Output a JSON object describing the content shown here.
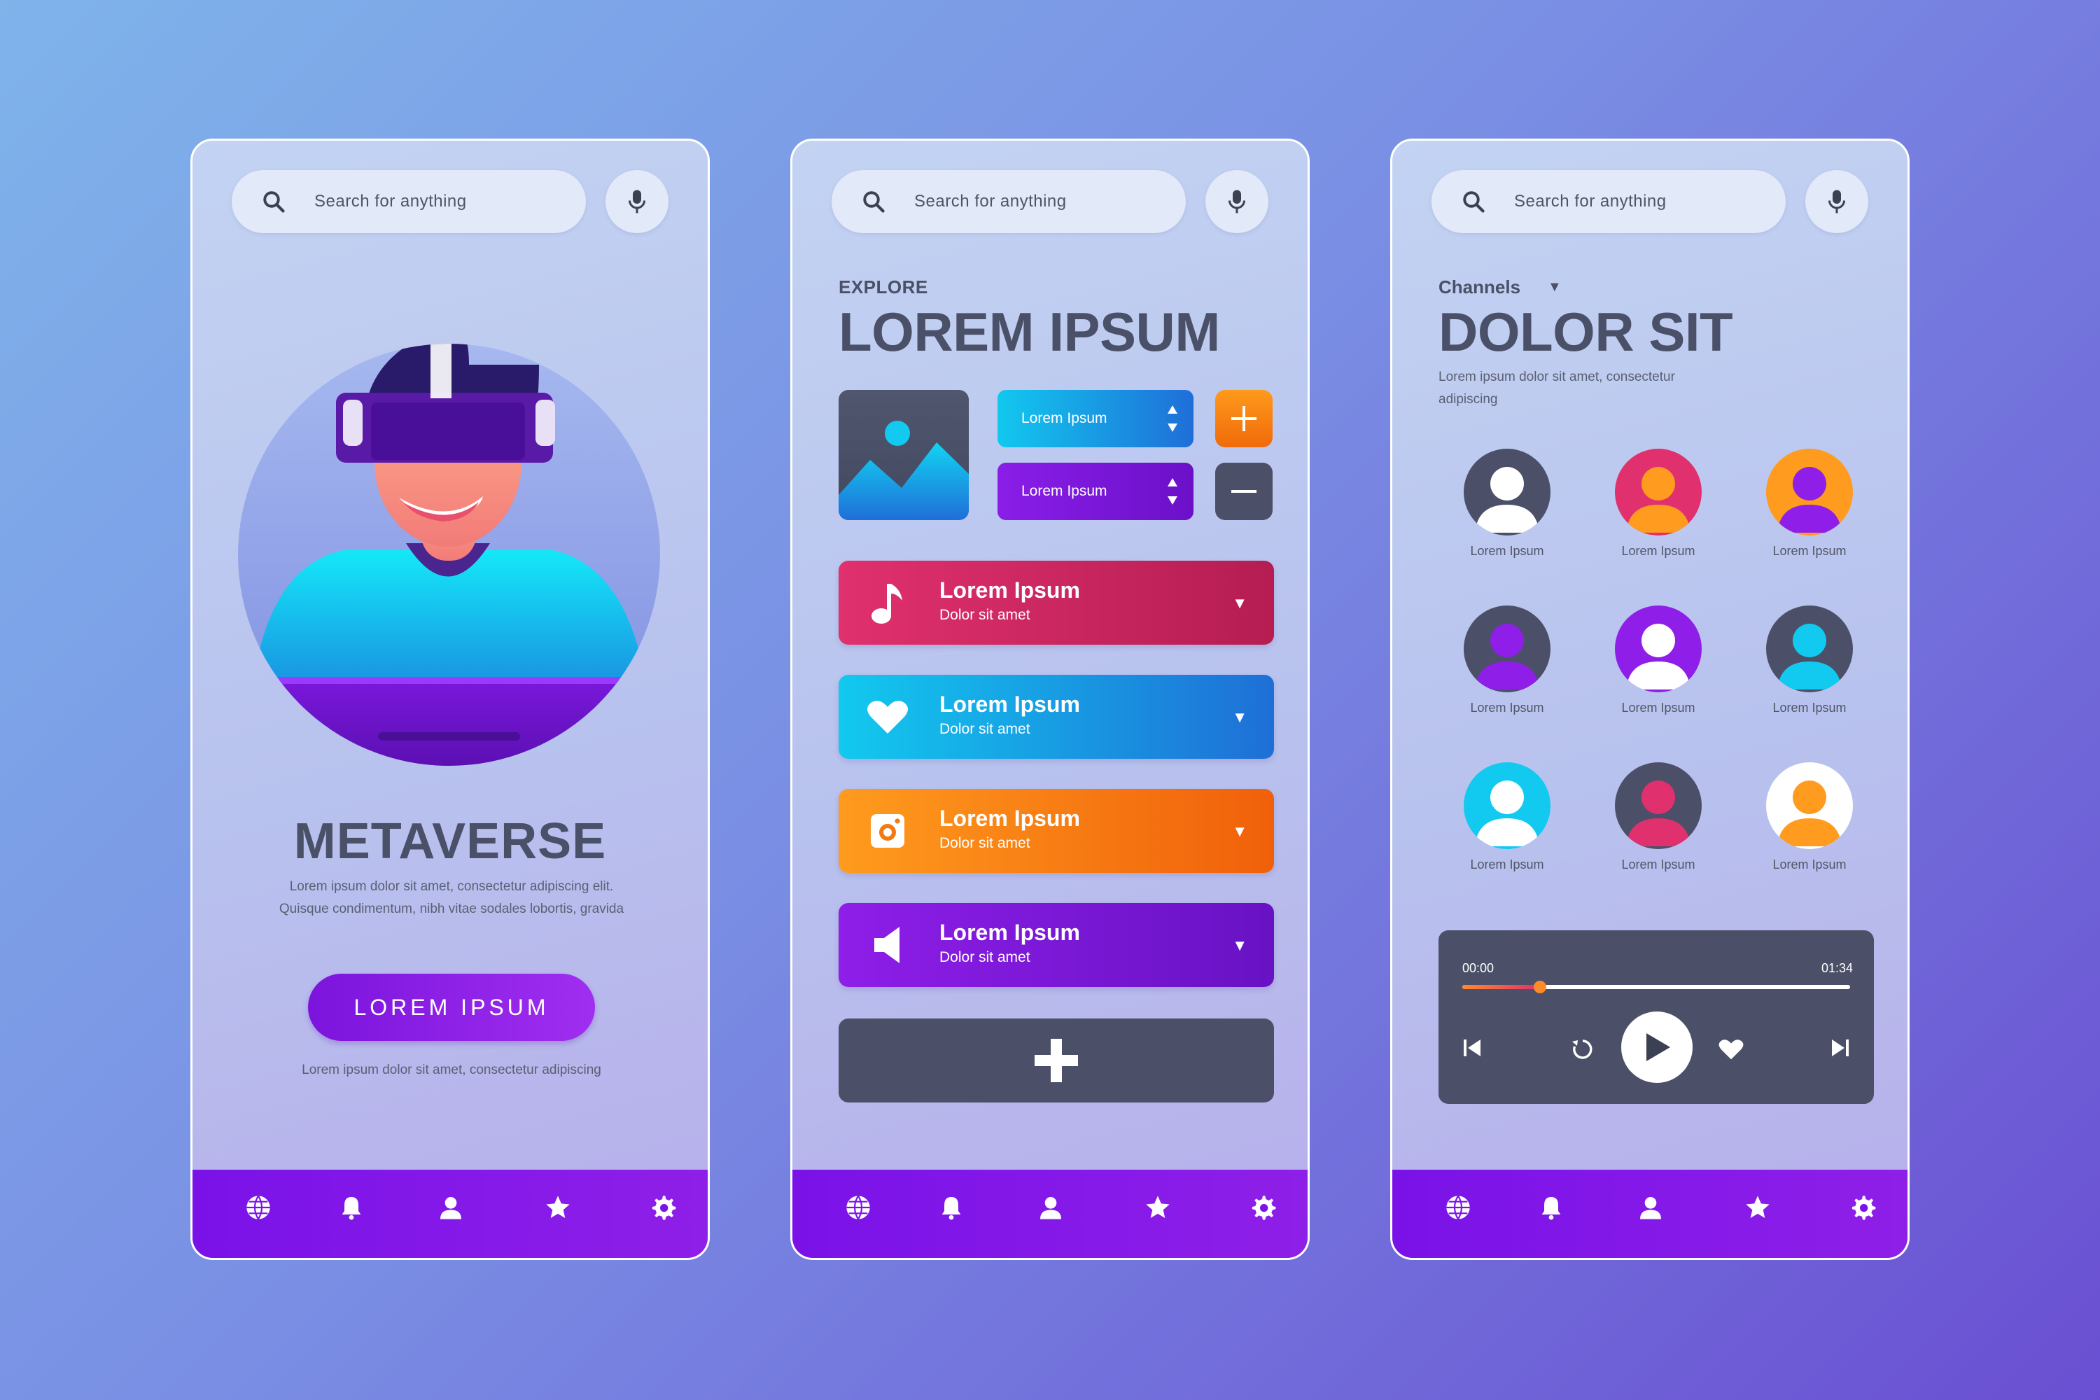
{
  "colors": {
    "accent_purple": "#7a12e8",
    "text_dark": "#4a5068",
    "card_pink": "#e0306e",
    "card_cyan": "#12c9ef",
    "card_orange": "#ff9b1e",
    "card_violet": "#8e1ee8",
    "slate": "#4b5068"
  },
  "search": {
    "placeholder": "Search for anything"
  },
  "nav_icons": [
    "globe-icon",
    "bell-icon",
    "user-icon",
    "star-icon",
    "gear-icon"
  ],
  "screen1": {
    "title": "METAVERSE",
    "description": "Lorem ipsum dolor sit amet, consectetur adipiscing elit. Quisque condimentum, nibh vitae sodales lobortis, gravida",
    "button_label": "LOREM IPSUM",
    "footnote": "Lorem ipsum dolor sit amet, consectetur adipiscing"
  },
  "screen2": {
    "eyebrow": "EXPLORE",
    "title": "LOREM IPSUM",
    "spinners": [
      {
        "label": "Lorem Ipsum"
      },
      {
        "label": "Lorem Ipsum"
      }
    ],
    "cards": [
      {
        "title": "Lorem Ipsum",
        "subtitle": "Dolor sit amet",
        "icon": "music-note-icon"
      },
      {
        "title": "Lorem Ipsum",
        "subtitle": "Dolor sit amet",
        "icon": "heart-icon"
      },
      {
        "title": "Lorem Ipsum",
        "subtitle": "Dolor sit amet",
        "icon": "camera-icon"
      },
      {
        "title": "Lorem Ipsum",
        "subtitle": "Dolor sit amet",
        "icon": "speaker-icon"
      }
    ]
  },
  "screen3": {
    "channels_label": "Channels",
    "title": "DOLOR SIT",
    "description": "Lorem ipsum dolor sit amet, consectetur adipiscing",
    "avatars": [
      {
        "name": "Lorem Ipsum",
        "bg": "#4b5068",
        "fg": "#ffffff"
      },
      {
        "name": "Lorem Ipsum",
        "bg": "#e0306e",
        "fg": "#ff9b1e"
      },
      {
        "name": "Lorem Ipsum",
        "bg": "#ff9b1e",
        "fg": "#8e1ee8"
      },
      {
        "name": "Lorem Ipsum",
        "bg": "#4b5068",
        "fg": "#8e1ee8"
      },
      {
        "name": "Lorem Ipsum",
        "bg": "#8e1ee8",
        "fg": "#ffffff"
      },
      {
        "name": "Lorem Ipsum",
        "bg": "#4b5068",
        "fg": "#12c9ef"
      },
      {
        "name": "Lorem Ipsum",
        "bg": "#12c9ef",
        "fg": "#ffffff"
      },
      {
        "name": "Lorem Ipsum",
        "bg": "#4b5068",
        "fg": "#e0306e"
      },
      {
        "name": "Lorem Ipsum",
        "bg": "#ffffff",
        "fg": "#ff9b1e"
      }
    ],
    "player": {
      "current_time": "00:00",
      "total_time": "01:34",
      "progress": 0.2
    }
  }
}
